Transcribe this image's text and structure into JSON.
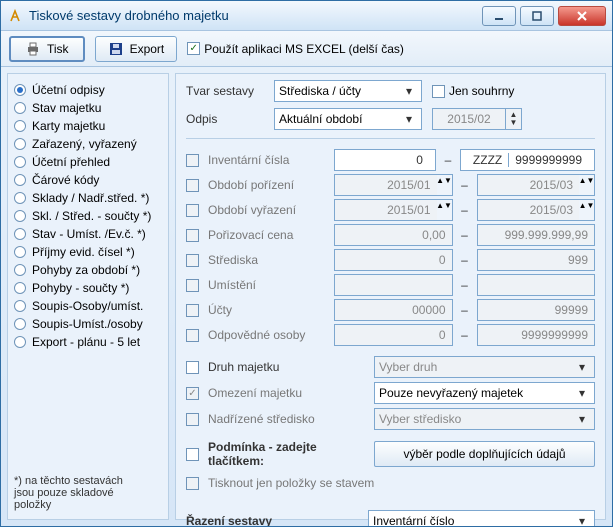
{
  "window": {
    "title": "Tiskové sestavy drobného majetku"
  },
  "toolbar": {
    "print": "Tisk",
    "export": "Export",
    "use_excel": "Použít aplikaci MS EXCEL (delší čas)",
    "use_excel_checked": true
  },
  "sidebar": {
    "items": [
      "Účetní odpisy",
      "Stav majetku",
      "Karty majetku",
      "Zařazený, vyřazený",
      "Účetní přehled",
      "Čárové kódy",
      "Sklady / Nadř.střed. *)",
      "Skl. / Střed. - součty *)",
      "Stav - Umíst. /Ev.č. *)",
      "Příjmy evid. čísel *)",
      "Pohyby za období *)",
      "Pohyby - součty *)",
      "Soupis-Osoby/umíst.",
      "Soupis-Umíst./osoby",
      "Export - plánu - 5 let"
    ],
    "selected_index": 0,
    "note_l1": "*) na těchto sestavách",
    "note_l2": "jsou pouze skladové",
    "note_l3": "položky"
  },
  "top": {
    "tvar_label": "Tvar sestavy",
    "tvar_value": "Střediska / účty",
    "odpis_label": "Odpis",
    "odpis_value": "Aktuální období",
    "souhrny_label": "Jen souhrny",
    "period": "2015/02"
  },
  "filters": {
    "f1": {
      "label": "Inventární čísla",
      "from_a": "",
      "from_b": "0",
      "to_a": "ZZZZ",
      "to_b": "9999999999"
    },
    "f2": {
      "label": "Období pořízení",
      "from": "2015/01",
      "to": "2015/03"
    },
    "f3": {
      "label": "Období vyřazení",
      "from": "2015/01",
      "to": "2015/03"
    },
    "f4": {
      "label": "Pořizovací cena",
      "from": "0,00",
      "to": "999.999.999,99"
    },
    "f5": {
      "label": "Střediska",
      "from": "0",
      "to": "999"
    },
    "f6": {
      "label": "Umístění",
      "from": "",
      "to": ""
    },
    "f7": {
      "label": "Účty",
      "from": "00000",
      "to": "99999"
    },
    "f8": {
      "label": "Odpovědné osoby",
      "from": "0",
      "to": "9999999999"
    }
  },
  "sec2": {
    "druh_label": "Druh majetku",
    "druh_value": "Vyber druh",
    "omez_label": "Omezení majetku",
    "omez_value": "Pouze nevyřazený majetek",
    "nadr_label": "Nadřízené středisko",
    "nadr_value": "Vyber středisko",
    "podm_label": "Podmínka - zadejte tlačítkem:",
    "podm_btn": "výběr podle doplňujících údajů",
    "stav_label": "Tisknout jen položky se stavem"
  },
  "sort": {
    "label": "Řazení sestavy",
    "value": "Inventární číslo"
  }
}
